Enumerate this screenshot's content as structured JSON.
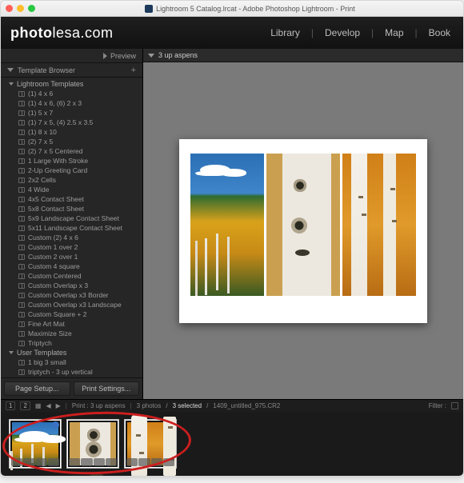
{
  "window": {
    "title": "Lightroom 5 Catalog.lrcat - Adobe Photoshop Lightroom - Print"
  },
  "header": {
    "logo_bold": "photo",
    "logo_rest": "lesa.com",
    "modules": [
      "Library",
      "Develop",
      "Map",
      "Book"
    ]
  },
  "left": {
    "preview_label": "Preview",
    "browser_label": "Template Browser",
    "plus": "+",
    "groups": [
      {
        "name": "Lightroom Templates",
        "items": [
          "(1) 4 x 6",
          "(1) 4 x 6, (6) 2 x 3",
          "(1) 5 x 7",
          "(1) 7 x 5, (4) 2.5 x 3.5",
          "(1) 8 x 10",
          "(2) 7 x 5",
          "(2) 7 x 5 Centered",
          "1 Large With Stroke",
          "2-Up Greeting Card",
          "2x2 Cells",
          "4 Wide",
          "4x5 Contact Sheet",
          "5x8 Contact Sheet",
          "5x9 Landscape Contact Sheet",
          "5x11 Landscape Contact Sheet",
          "Custom (2) 4 x 6",
          "Custom 1 over 2",
          "Custom 2 over 1",
          "Custom 4 square",
          "Custom Centered",
          "Custom Overlap x 3",
          "Custom Overlap x3 Border",
          "Custom Overlap x3 Landscape",
          "Custom Square + 2",
          "Fine Art Mat",
          "Maximize Size",
          "Triptych"
        ]
      },
      {
        "name": "User Templates",
        "items": [
          "1 big 3 small",
          "triptych - 3 up vertical"
        ]
      }
    ],
    "page_setup": "Page Setup...",
    "print_settings": "Print Settings..."
  },
  "view": {
    "title": "3 up aspens"
  },
  "toolbar": {
    "pages": [
      "1",
      "2"
    ],
    "print_label": "Print : 3 up aspens",
    "photo_count": "3 photos",
    "selected": "3 selected",
    "filename": "1409_untitled_975.CR2",
    "filter_label": "Filter :"
  },
  "filmstrip": {
    "thumbs": [
      "t1",
      "t2",
      "t3"
    ]
  }
}
